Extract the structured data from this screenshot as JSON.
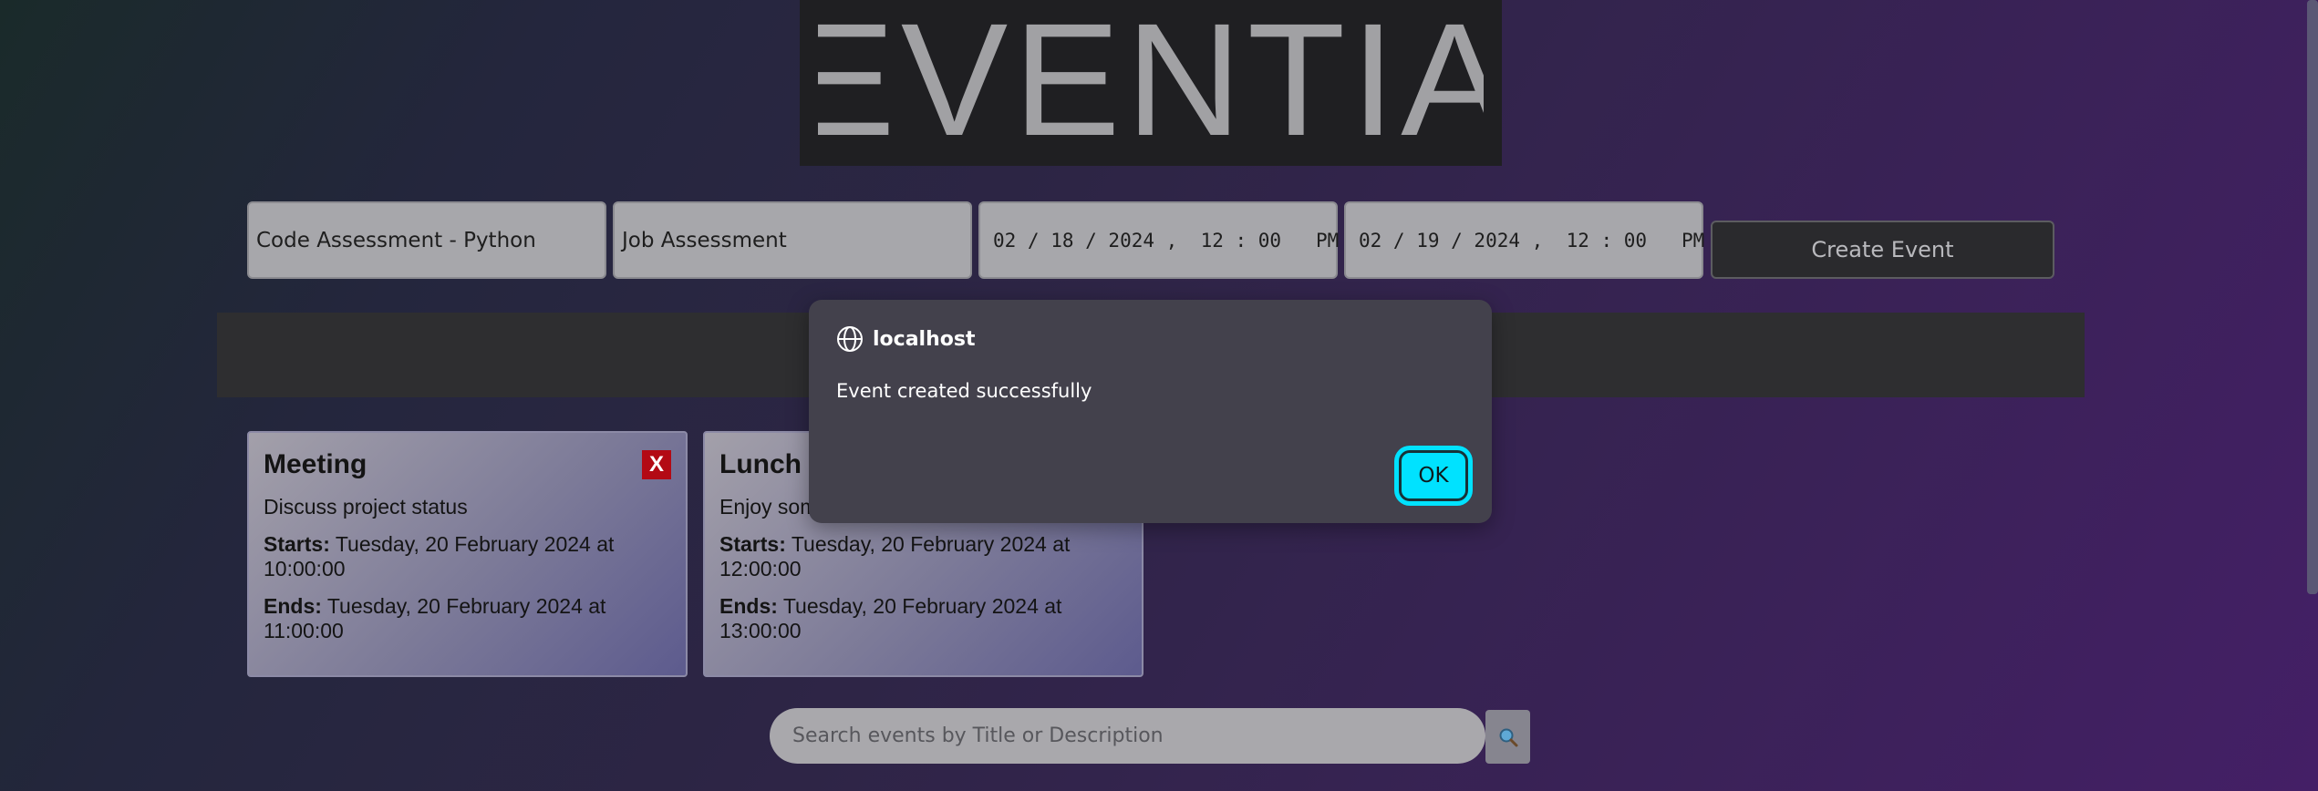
{
  "app": {
    "logo_text": "EVENTIA"
  },
  "form": {
    "title_value": "Code Assessment - Python",
    "description_value": "Job Assessment",
    "start_value": "02 / 18 / 2024 ,  12 : 00   PM",
    "end_value": "02 / 19 / 2024 ,  12 : 00   PM",
    "create_label": "Create Event"
  },
  "events": [
    {
      "title": "Meeting",
      "description": "Discuss project status",
      "starts_label": "Starts:",
      "starts_value": " Tuesday, 20 February 2024 at 10:00:00",
      "ends_label": "Ends:",
      "ends_value": " Tuesday, 20 February 2024 at 11:00:00",
      "delete_label": "X"
    },
    {
      "title": "Lunch",
      "description": "Enjoy som",
      "starts_label": "Starts:",
      "starts_value": " Tuesday, 20 February 2024 at 12:00:00",
      "ends_label": "Ends:",
      "ends_value": " Tuesday, 20 February 2024 at 13:00:00"
    }
  ],
  "search": {
    "placeholder": "Search events by Title or Description",
    "icon": "search-icon"
  },
  "dialog": {
    "host": "localhost",
    "message": "Event created successfully",
    "ok_label": "OK"
  },
  "colors": {
    "accent": "#00e2ff",
    "delete": "#b30a14"
  }
}
